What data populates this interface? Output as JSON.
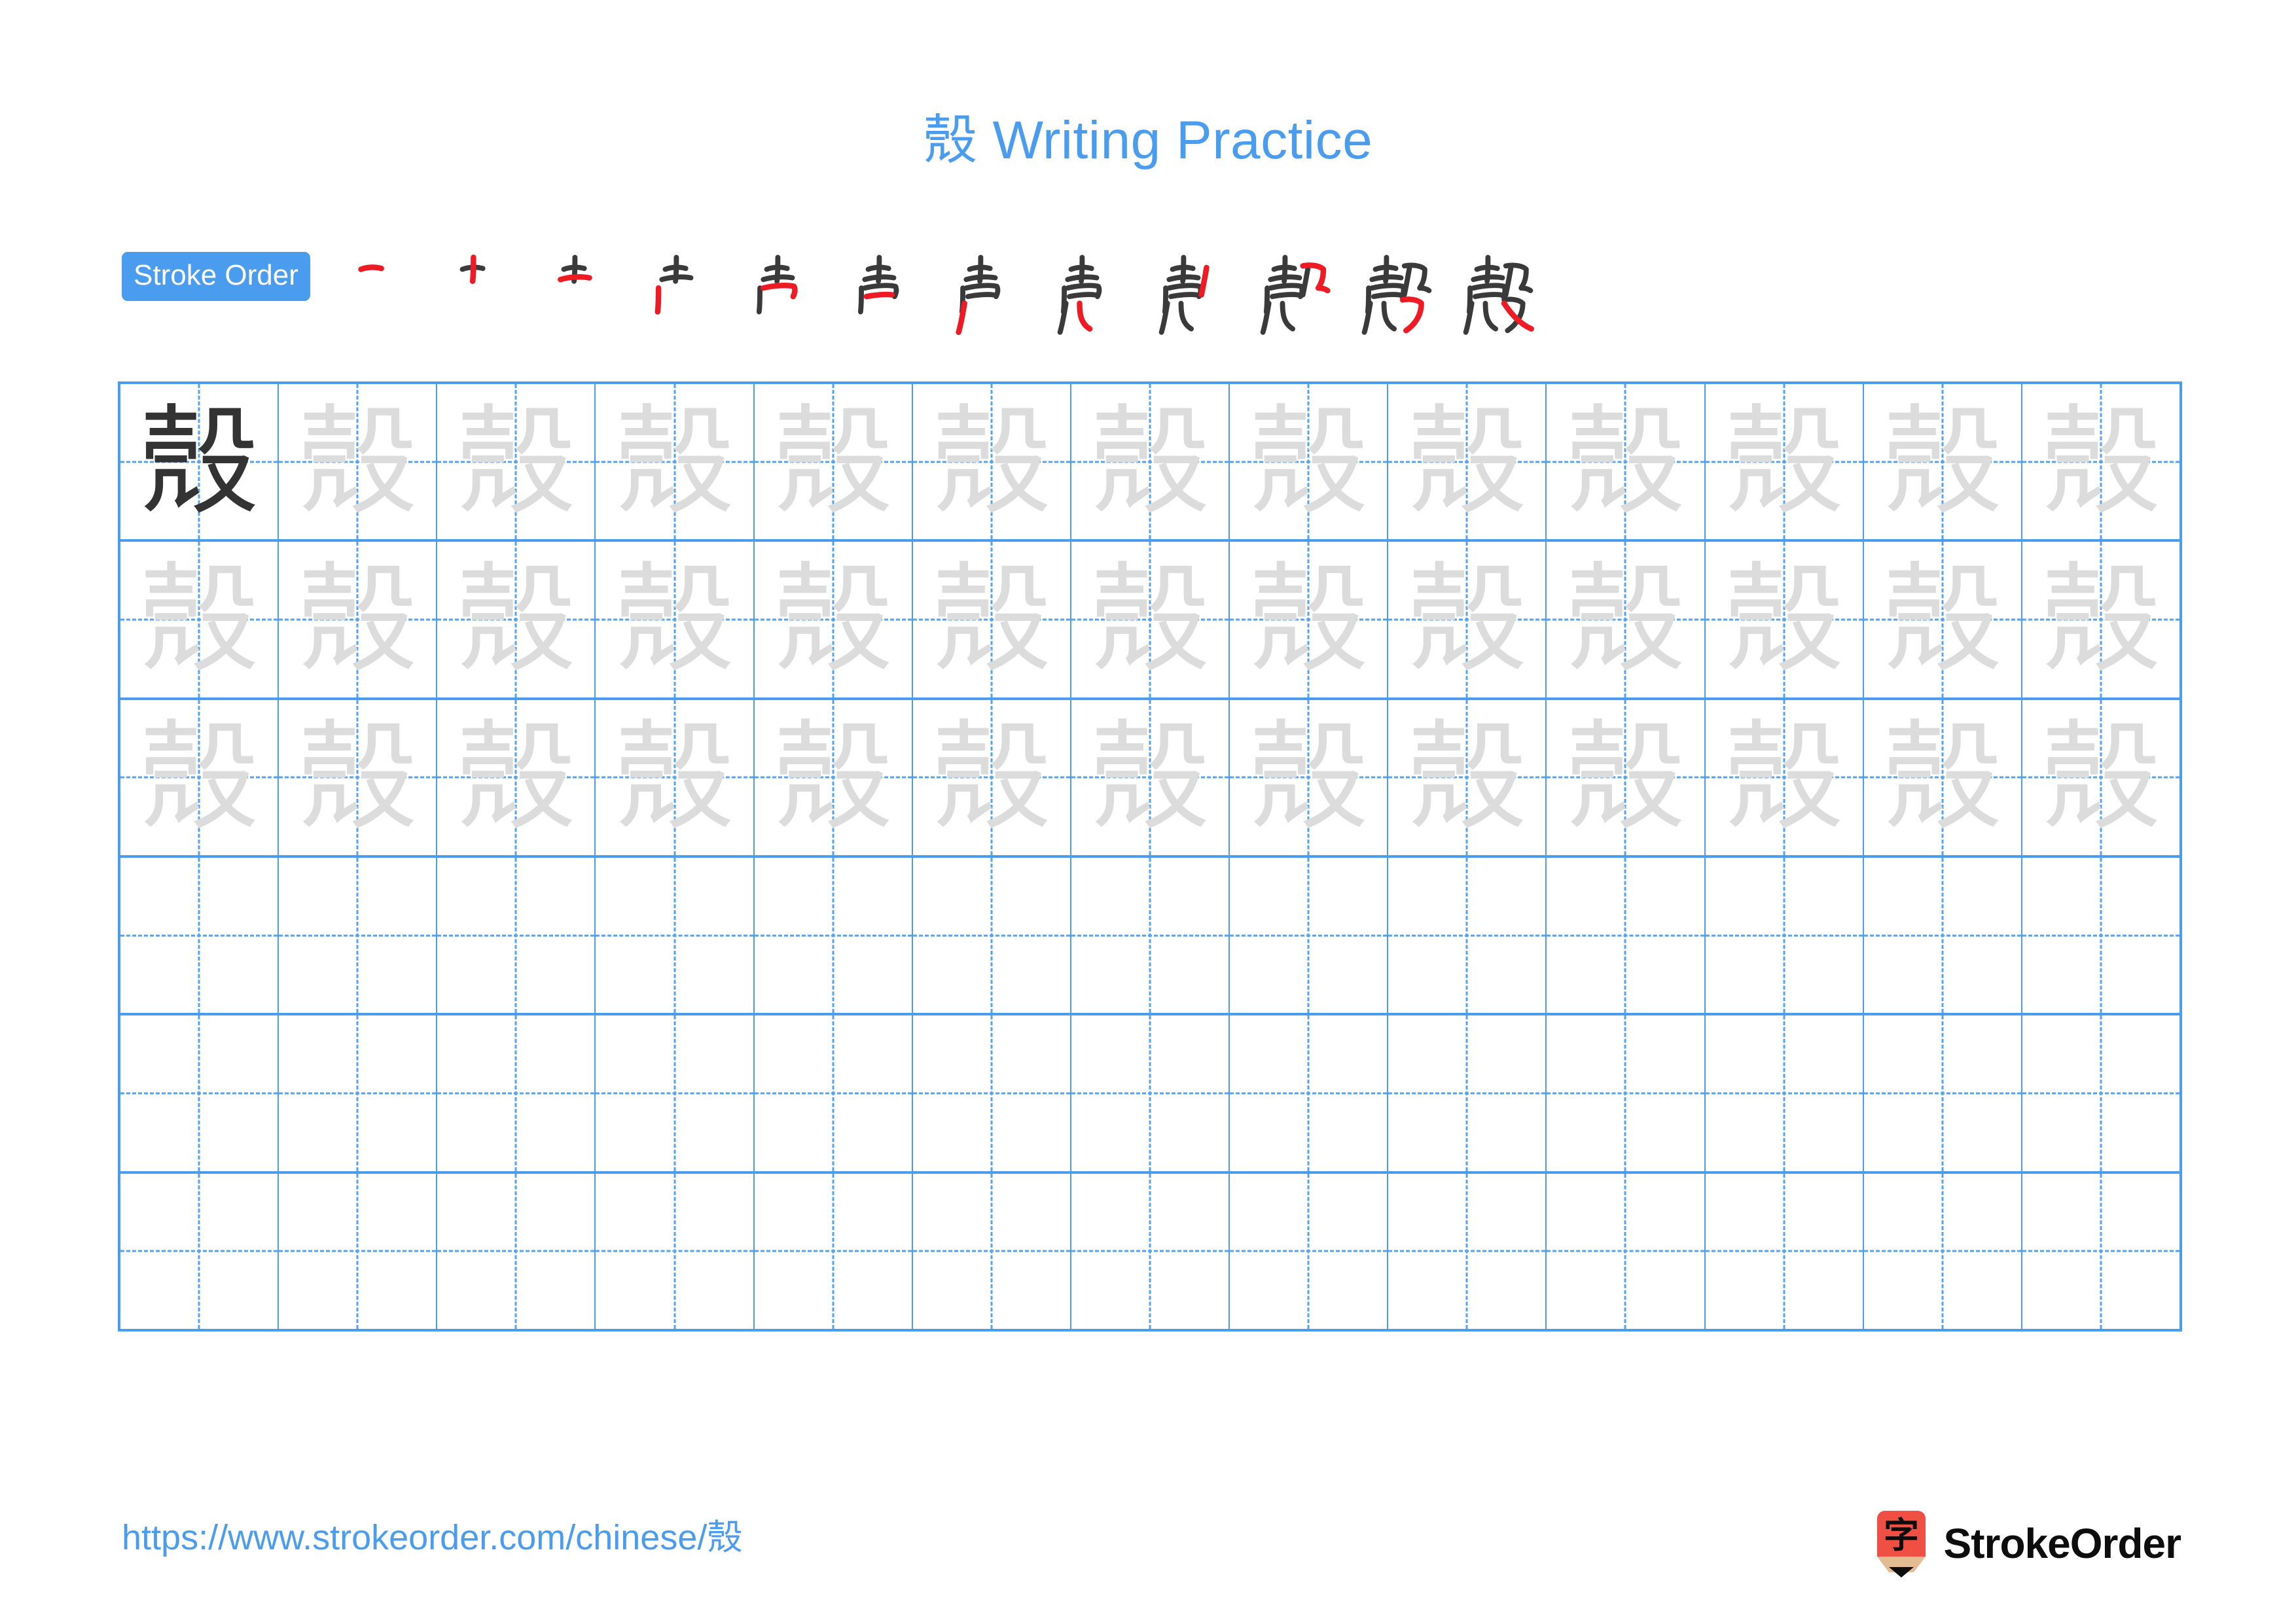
{
  "document": {
    "character": "殼",
    "title": "殼 Writing Practice",
    "title_character": "殼",
    "title_suffix": " Writing Practice"
  },
  "stroke_order": {
    "badge_label": "Stroke Order",
    "total_strokes": 12,
    "steps": [
      {
        "index": 1,
        "cumulative": "一",
        "new_stroke": "heng"
      },
      {
        "index": 2,
        "cumulative": "十",
        "new_stroke": "shu"
      },
      {
        "index": 3,
        "cumulative": "士",
        "new_stroke": "heng"
      },
      {
        "index": 4,
        "cumulative": "士丿",
        "new_stroke": "pie"
      },
      {
        "index": 5,
        "cumulative": "声",
        "new_stroke": "hengzhe"
      },
      {
        "index": 6,
        "cumulative": "吉",
        "new_stroke": "heng"
      },
      {
        "index": 7,
        "cumulative": "声",
        "new_stroke": "pie"
      },
      {
        "index": 8,
        "cumulative": "壳",
        "new_stroke": "shuwan"
      },
      {
        "index": 9,
        "cumulative": "㱿",
        "new_stroke": "pie"
      },
      {
        "index": 10,
        "cumulative": "殻",
        "new_stroke": "hengzhegou"
      },
      {
        "index": 11,
        "cumulative": "殼",
        "new_stroke": "wangou"
      },
      {
        "index": 12,
        "cumulative": "殼",
        "new_stroke": "na"
      }
    ]
  },
  "practice_grid": {
    "columns": 13,
    "rows": 6,
    "traced_rows": 3,
    "blank_rows": 3,
    "model_cell": {
      "row": 0,
      "column": 0,
      "character": "殼"
    },
    "trace_character": "殼"
  },
  "footer": {
    "url": "https://www.strokeorder.com/chinese/殼",
    "brand_name": "StrokeOrder",
    "brand_mark_character": "字"
  },
  "colors": {
    "accent_blue": "#4a9cef",
    "grid_line": "#4a9cef",
    "guide_dash": "#53a3f0",
    "model_char": "#333333",
    "trace_char": "#dcdcdc",
    "stroke_new": "#ee1b24",
    "stroke_old": "#3a3a3a",
    "brand_red": "#f05043",
    "brand_wood": "#e3bd91",
    "brand_text": "#0d0d0d"
  }
}
